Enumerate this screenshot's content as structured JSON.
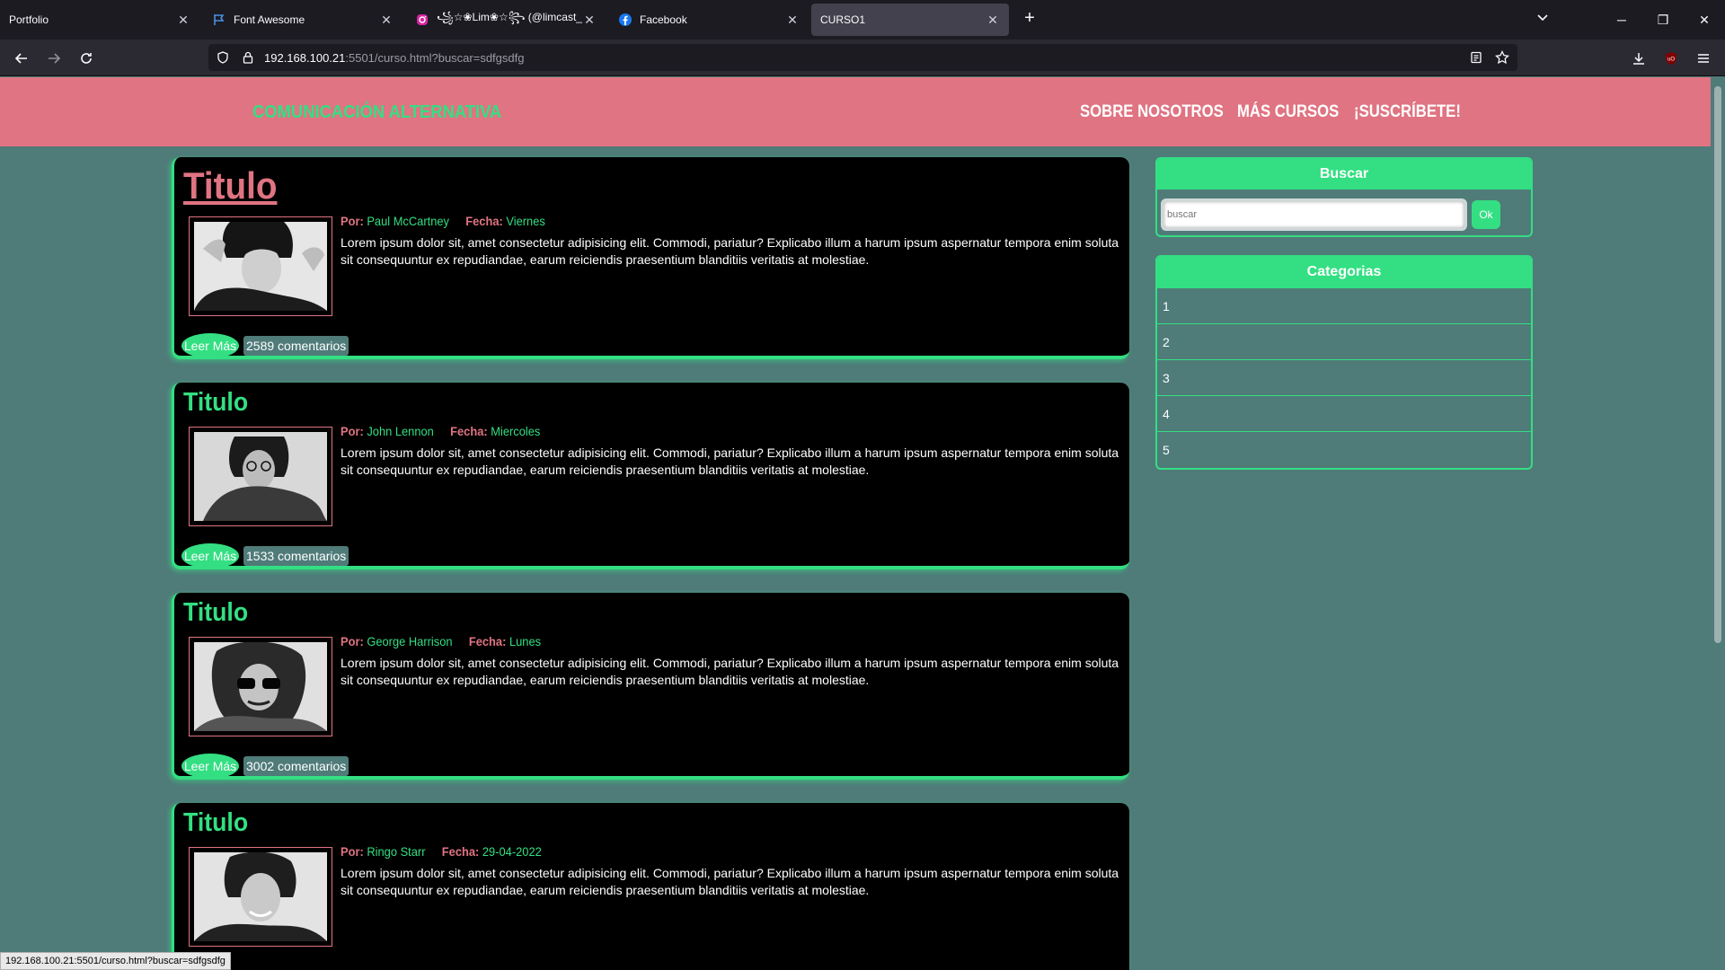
{
  "browser": {
    "tabs": [
      {
        "label": "Portfolio",
        "icon": "none"
      },
      {
        "label": "Font Awesome",
        "icon": "flag-icon"
      },
      {
        "label": "꧁☆❀Lim❀☆꧂ (@limcast_)",
        "icon": "instagram-icon"
      },
      {
        "label": "Facebook",
        "icon": "facebook-icon"
      },
      {
        "label": "CURSO1",
        "icon": "none"
      }
    ],
    "url_host": "192.168.100.21",
    "url_rest": ":5501/curso.html?buscar=sdfgsdfg",
    "status_url": "192.168.100.21:5501/curso.html?buscar=sdfgsdfg"
  },
  "header": {
    "brand": "COMUNICACIÓN ALTERNATIVA",
    "menu": [
      "SOBRE NOSOTROS",
      "MÁS CURSOS",
      "¡SUSCRÍBETE!"
    ]
  },
  "labels": {
    "by": "Por:",
    "date": "Fecha:",
    "read_more": "Leer Más"
  },
  "posts": [
    {
      "title": "Titulo",
      "author": "Paul McCartney",
      "date": "Viernes",
      "excerpt": "Lorem ipsum dolor sit, amet consectetur adipisicing elit. Commodi, pariatur? Explicabo illum a harum ipsum aspernatur tempora enim soluta sit consequuntur ex repudiandae, earum reiciendis praesentium blanditiis veritatis at molestiae.",
      "comments": "2589 comentarios"
    },
    {
      "title": "Titulo",
      "author": "John Lennon",
      "date": "Miercoles",
      "excerpt": "Lorem ipsum dolor sit, amet consectetur adipisicing elit. Commodi, pariatur? Explicabo illum a harum ipsum aspernatur tempora enim soluta sit consequuntur ex repudiandae, earum reiciendis praesentium blanditiis veritatis at molestiae.",
      "comments": "1533 comentarios"
    },
    {
      "title": "Titulo",
      "author": "George Harrison",
      "date": "Lunes",
      "excerpt": "Lorem ipsum dolor sit, amet consectetur adipisicing elit. Commodi, pariatur? Explicabo illum a harum ipsum aspernatur tempora enim soluta sit consequuntur ex repudiandae, earum reiciendis praesentium blanditiis veritatis at molestiae.",
      "comments": "3002 comentarios"
    },
    {
      "title": "Titulo",
      "author": "Ringo Starr",
      "date": "29-04-2022",
      "excerpt": "Lorem ipsum dolor sit, amet consectetur adipisicing elit. Commodi, pariatur? Explicabo illum a harum ipsum aspernatur tempora enim soluta sit consequuntur ex repudiandae, earum reiciendis praesentium blanditiis veritatis at molestiae.",
      "comments": ""
    }
  ],
  "sidebar": {
    "search_title": "Buscar",
    "search_placeholder": "buscar",
    "search_button": "Ok",
    "categories_title": "Categorias",
    "categories": [
      "1",
      "2",
      "3",
      "4",
      "5"
    ]
  },
  "colors": {
    "accent_green": "#33df82",
    "accent_pink": "#e07482",
    "page_bg": "#4f7b79"
  }
}
